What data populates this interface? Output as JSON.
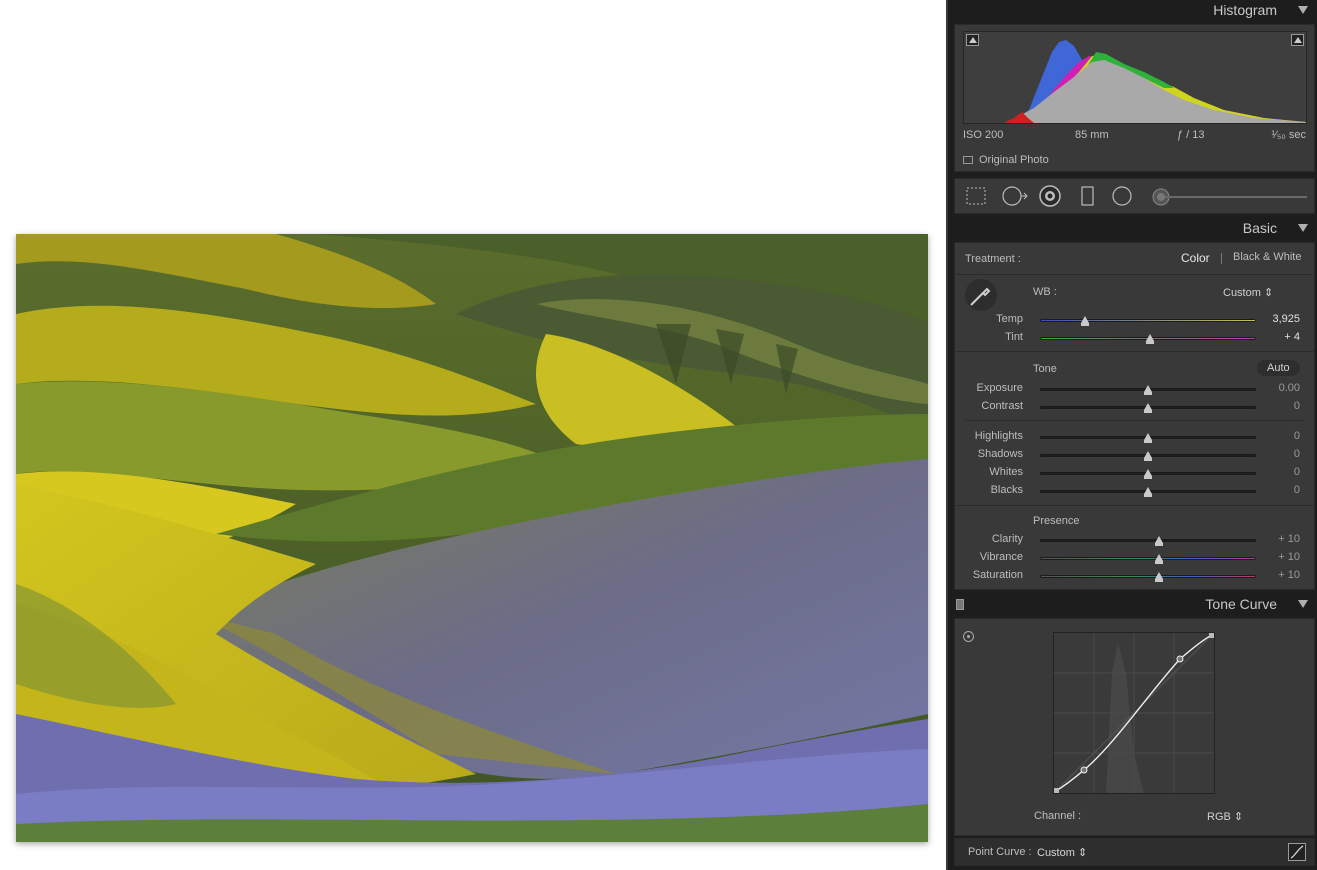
{
  "panels": {
    "histogram": {
      "title": "Histogram",
      "iso": "ISO 200",
      "focal_length": "85 mm",
      "aperture": "ƒ / 13",
      "shutter": "¹⁄₅₀ sec",
      "original_photo_label": "Original Photo"
    },
    "basic": {
      "title": "Basic",
      "treatment_label": "Treatment :",
      "treatment_color": "Color",
      "treatment_bw": "Black & White",
      "wb_label": "WB :",
      "wb_value": "Custom ⇕",
      "temp_label": "Temp",
      "temp_value": "3,925",
      "temp_level": 0.2,
      "tint_label": "Tint",
      "tint_value": "+ 4",
      "tint_level": 0.51,
      "tone_label": "Tone",
      "auto_label": "Auto",
      "exposure_label": "Exposure",
      "exposure_value": "0.00",
      "contrast_label": "Contrast",
      "contrast_value": "0",
      "highlights_label": "Highlights",
      "highlights_value": "0",
      "shadows_label": "Shadows",
      "shadows_value": "0",
      "whites_label": "Whites",
      "whites_value": "0",
      "blacks_label": "Blacks",
      "blacks_value": "0",
      "presence_label": "Presence",
      "clarity_label": "Clarity",
      "clarity_value": "+ 10",
      "vibrance_label": "Vibrance",
      "vibrance_value": "+ 10",
      "saturation_label": "Saturation",
      "saturation_value": "+ 10"
    },
    "tone_curve": {
      "title": "Tone Curve",
      "channel_label": "Channel :",
      "channel_value": "RGB ⇕",
      "point_curve_label": "Point Curve :",
      "point_curve_value": "Custom ⇕"
    }
  },
  "colors": {
    "panel_bg": "#393939",
    "accent": "#e0e0e0"
  },
  "icons": [
    "crop-icon",
    "spot-removal-icon",
    "red-eye-icon",
    "graduated-filter-icon",
    "radial-filter-icon",
    "adjustment-brush-icon",
    "eyedropper-icon",
    "target-adjust-icon",
    "curve-mode-icon"
  ]
}
